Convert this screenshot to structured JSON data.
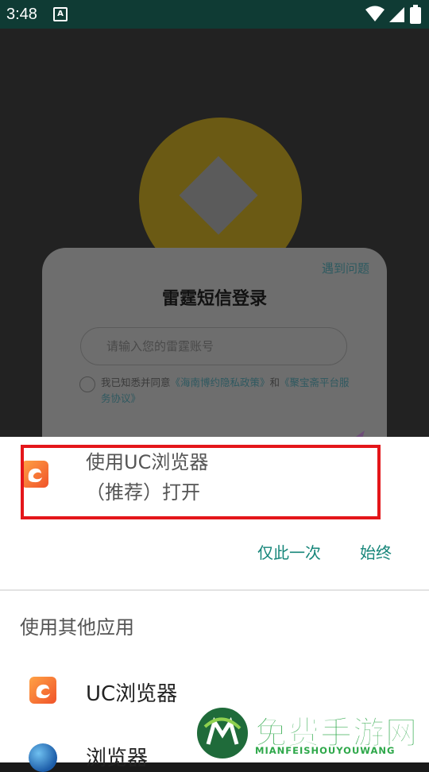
{
  "status_bar": {
    "time": "3:48",
    "notification_letter": "A"
  },
  "background_app": {
    "help_link": "遇到问题",
    "login_title": "雷霆短信登录",
    "account_placeholder": "请输入您的雷霆账号",
    "agree_prefix": "我已知悉并同意",
    "privacy_link": "《海南博约隐私政策》",
    "agree_and": "和",
    "service_link": "《聚宝斋平台服务协议》"
  },
  "chooser": {
    "recommended_line1": "使用UC浏览器",
    "recommended_line2": "（推荐）打开",
    "just_once": "仅此一次",
    "always": "始终",
    "other_apps_title": "使用其他应用",
    "apps": [
      {
        "label": "UC浏览器",
        "icon": "uc-browser-icon"
      },
      {
        "label": "浏览器",
        "icon": "browser-globe-icon"
      }
    ]
  },
  "watermark": {
    "title": "免费手游网",
    "subtitle": "MIANFEISHOUYOUWANG"
  },
  "colors": {
    "status_bar": "#0f3b34",
    "accent": "#17867a",
    "highlight_box": "#e4161a",
    "watermark": "#2ea84a"
  }
}
